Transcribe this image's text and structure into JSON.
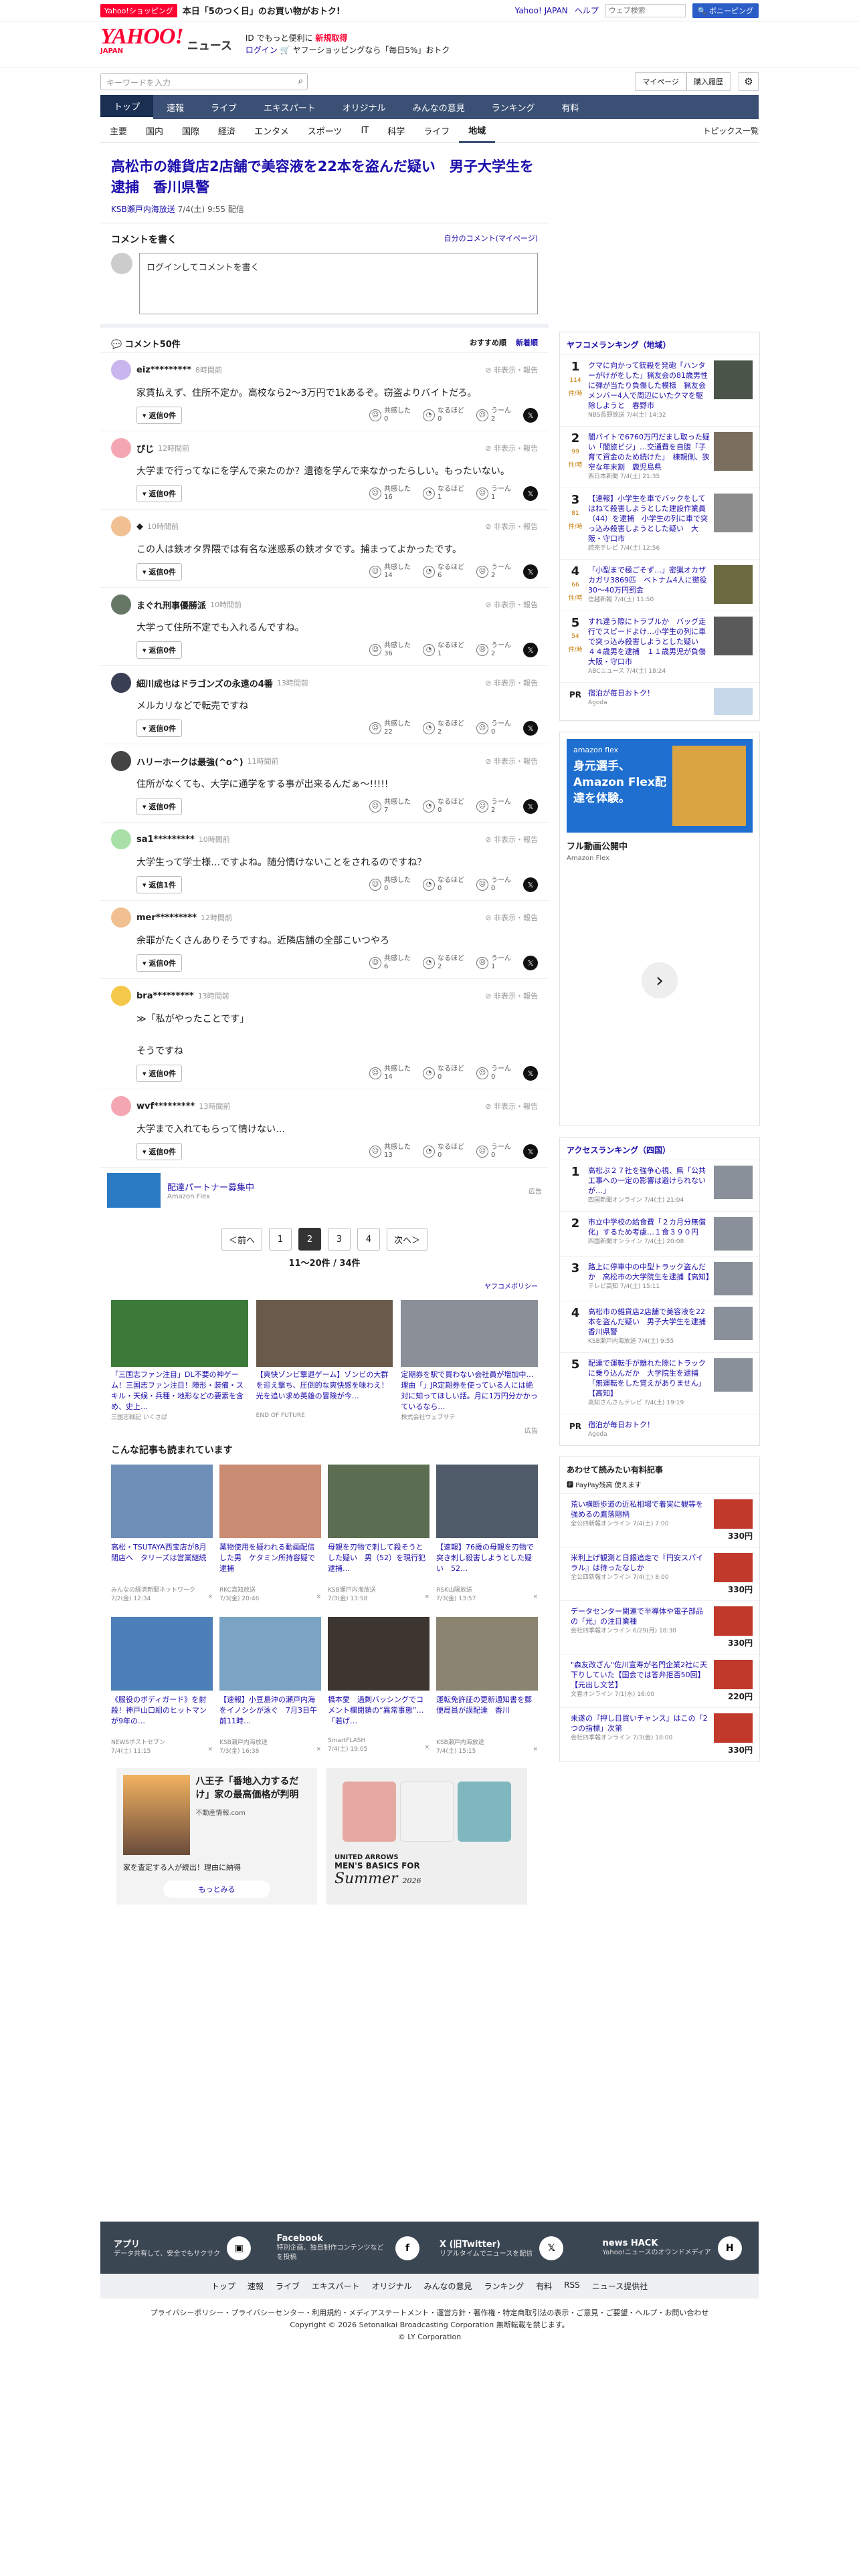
{
  "topbar": {
    "promo_tag": "Yahoo!ショッピング",
    "promo_text": "本日「5のつく日」のお買い物がおトク!",
    "links": [
      "Yahoo! JAPAN",
      "ヘルプ"
    ],
    "search_placeholder": "ウェブ検索",
    "search_btn": "🔍 ボニーピング"
  },
  "header": {
    "logo": "YAHOO!",
    "logo_sub": "JAPAN",
    "section": "ニュース",
    "notice1": "ID でもっと便利に",
    "notice_red": "新規取得",
    "notice2": "ログイン",
    "notice3": "ヤフーショッピングなら「毎日5%」おトク"
  },
  "search": {
    "placeholder": "キーワードを入力",
    "mypage": "マイページ",
    "history": "購入履歴"
  },
  "nav": [
    "トップ",
    "速報",
    "ライブ",
    "エキスパート",
    "オリジナル",
    "みんなの意見",
    "ランキング",
    "有料"
  ],
  "subnav": [
    "主要",
    "国内",
    "国際",
    "経済",
    "エンタメ",
    "スポーツ",
    "IT",
    "科学",
    "ライフ",
    "地域"
  ],
  "subnav_right": "トピックス一覧",
  "article": {
    "title": "高松市の雑貨店2店舗で美容液を22本を盗んだ疑い　男子大学生を逮捕　香川県警",
    "source": "KSB瀬戸内海放送",
    "date": "7/4(土) 9:55 配信"
  },
  "comment_box": {
    "title": "コメントを書く",
    "mylink": "自分のコメント(マイページ)",
    "placeholder": "ログインしてコメントを書く"
  },
  "comments_header": {
    "count": "コメント50件",
    "sort1": "おすすめ順",
    "sort2": "新着順"
  },
  "comments": [
    {
      "user": "eiz*********",
      "time": "8時間前",
      "report": "非表示・報告",
      "body": "家賃払えず、住所不定か。高校なら2～3万円で1kあるぞ。窃盗よりバイトだろ。",
      "reply": "返信0件",
      "r1": "0",
      "r2": "0",
      "r3": "2",
      "color": "#c9b6ef"
    },
    {
      "user": "ぴじ",
      "time": "12時間前",
      "report": "非表示・報告",
      "body": "大学まで行ってなにを学んで来たのか？遺徳を学んで来なかったらしい。もったいない。",
      "reply": "返信0件",
      "r1": "16",
      "r2": "1",
      "r3": "1",
      "color": "#f4a7b3"
    },
    {
      "user": "◆",
      "time": "10時間前",
      "report": "非表示・報告",
      "body": "この人は鉄オタ界隈では有名な迷惑系の鉄オタです。捕まってよかったです。",
      "reply": "返信0件",
      "r1": "14",
      "r2": "6",
      "r3": "2",
      "color": "#f1c092"
    },
    {
      "user": "まぐれ刑事優勝派",
      "time": "10時間前",
      "report": "非表示・報告",
      "body": "大学って住所不定でも入れるんですね。",
      "reply": "返信0件",
      "r1": "36",
      "r2": "1",
      "r3": "2",
      "color": "#667766"
    },
    {
      "user": "細川成也はドラゴンズの永遠の4番",
      "time": "13時間前",
      "report": "非表示・報告",
      "body": "メルカリなどで転売ですね",
      "reply": "返信0件",
      "r1": "22",
      "r2": "2",
      "r3": "0",
      "color": "#3a3f55"
    },
    {
      "user": "ハリーホークは最強(^o^)",
      "time": "11時間前",
      "report": "非表示・報告",
      "body": "住所がなくても、大学に通学をする事が出来るんだぁ～!!!!!",
      "reply": "返信0件",
      "r1": "7",
      "r2": "0",
      "r3": "2",
      "color": "#444444"
    },
    {
      "user": "sa1*********",
      "time": "10時間前",
      "report": "非表示・報告",
      "body": "大学生って学士様…ですよね。随分情けないことをされるのですね？",
      "reply": "返信1件",
      "r1": "0",
      "r2": "0",
      "r3": "0",
      "color": "#a8e0a8"
    },
    {
      "user": "mer*********",
      "time": "12時間前",
      "report": "非表示・報告",
      "body": "余罪がたくさんありそうですね。近隣店舗の全部こいつやろ",
      "reply": "返信0件",
      "r1": "6",
      "r2": "2",
      "r3": "1",
      "color": "#f1c092"
    },
    {
      "user": "bra*********",
      "time": "13時間前",
      "report": "非表示・報告",
      "body": "≫「私がやったことです」\n\nそうですね",
      "reply": "返信0件",
      "r1": "14",
      "r2": "0",
      "r3": "0",
      "color": "#f4c94a"
    },
    {
      "user": "wvf*********",
      "time": "13時間前",
      "report": "非表示・報告",
      "body": "大学まで入れてもらって情けない…",
      "reply": "返信0件",
      "r1": "13",
      "r2": "0",
      "r3": "0",
      "color": "#f4a7b3"
    }
  ],
  "reaction_labels": {
    "a": "共感した",
    "b": "なるほど",
    "c": "うーん"
  },
  "ad_partner": {
    "title": "配達パートナー募集中",
    "sub": "Amazon Flex",
    "ad": "広告"
  },
  "pager": {
    "prev": "＜前へ",
    "pages": [
      "1",
      "2",
      "3",
      "4"
    ],
    "current": "2",
    "next": "次へ＞",
    "count": "11〜20件 / 34件"
  },
  "sponsor": "ヤフコメポリシー",
  "promo_cards": [
    {
      "t": "「三国志ファン注目」DL不要の神ゲーム！三国志ファン注目！陣形・装備・スキル・天候・兵種・地形などの要素を含め、史上…",
      "s": "三国志戦記 いくさば",
      "bg": "#3d7a3a"
    },
    {
      "t": "【爽快ゾンビ撃退ゲーム】ゾンビの大群を迎え撃ち、圧倒的な爽快感を味わえ！光を追い求め英雄の冒険が今…",
      "s": "END OF FUTURE",
      "bg": "#6a5a4a"
    },
    {
      "t": "定期券を駅で買わない会社員が増加中…理由「」JR定期券を使っている人には絶対に知ってほしい話。月に1万円分かかっているなら…",
      "s": "株式会社ウェブサテ",
      "bg": "#8a8f98"
    }
  ],
  "ad_label": "広告",
  "read_heading": "こんな記事も読まれています",
  "read_cards": [
    {
      "t": "高松・TSUTAYA西宝店が8月閉店へ　タリーズは営業継続",
      "s": "みんなの経済新聞ネットワーク",
      "d": "7/2(金) 12:34",
      "bg": "#6d8fb7"
    },
    {
      "t": "薬物使用を疑われる動画配信した男　ケタミン所持容疑で逮捕",
      "s": "RKC高知放送",
      "d": "7/3(金) 20:46",
      "bg": "#c98c73"
    },
    {
      "t": "母親を刃物で刺して殺そうとした疑い　男（52）を現行犯逮捕…",
      "s": "KSB瀬戸内海放送",
      "d": "7/3(金) 13:58",
      "bg": "#5c6e52"
    },
    {
      "t": "【速報】76歳の母親を刃物で突き刺し殺害しようとした疑い　52…",
      "s": "RSK山陽放送",
      "d": "7/3(金) 13:57",
      "bg": "#4f5b68"
    },
    {
      "t": "《服役のボディガード》を射殺！神戸山口組のヒットマンが9年の…",
      "s": "NEWSポストセブン",
      "d": "7/4(土) 11:15",
      "bg": "#4d80b9"
    },
    {
      "t": "【速報】小豆島沖の瀬戸内海をイノシシが泳ぐ　7月3日午前11時…",
      "s": "KSB瀬戸内海放送",
      "d": "7/3(金) 16:38",
      "bg": "#7ba4c4"
    },
    {
      "t": "橋本愛　過剰バッシングでコメント欄閉鎖の“異常事態”…「若げ…",
      "s": "SmartFLASH",
      "d": "7/4(土) 19:05",
      "bg": "#3c3530"
    },
    {
      "t": "運転免許証の更新通知書を郵便局員が誤配達　香川",
      "s": "KSB瀬戸内海放送",
      "d": "7/4(土) 15:15",
      "bg": "#8a8470"
    }
  ],
  "house_ad": {
    "head": "八王子「番地入力するだけ」家の最高価格が判明",
    "site": "不動産情報.com",
    "desc": "家を査定する人が続出！理由に納得",
    "btn": "もっとみる"
  },
  "cloth_ad": {
    "brand": "UNITED ARROWS",
    "text": "MEN'S BASICS FOR",
    "summer": "Summer",
    "year": "2026"
  },
  "side_rank": {
    "title": "ヤフコメランキング（地域）",
    "items": [
      {
        "n": "1",
        "c": "114",
        "cu": "件/時",
        "t": "クマに向かって銃殺を発砲「ハンターがけがをした」猟友会の81歳男性に弾が当たり負傷した模様　猟友会メンバー4人で周辺にいたクマを駆除しようと　春野市",
        "s": "NBS長野放送 7/4(土) 14:32",
        "bg": "#4a5448"
      },
      {
        "n": "2",
        "c": "99",
        "cu": "件/時",
        "t": "闇バイトで6760万円だまし取った疑い「闇旅ビジ」…交通費を自腹「子育て資金のため続けた」　棟親側、狭窄な年末割　鹿児島県",
        "s": "西日本新聞 7/4(土) 21:35",
        "bg": "#7a6e5e"
      },
      {
        "n": "3",
        "c": "81",
        "cu": "件/時",
        "t": "【速報】小学生を車でバックをしてはねて殺害しようとした建設作業員（44）を逮捕　小学生の列に車で突っ込み殺害しようとした疑い　大阪・守口市",
        "s": "読売テレビ 7/4(土) 12:56",
        "bg": "#8c8c8c"
      },
      {
        "n": "4",
        "c": "66",
        "cu": "件/時",
        "t": "「小型まで極ごそず…」密猟オカザカガリ3869匹　ベトナム4人に懲役30～40万円罰金",
        "s": "信越新報 7/4(土) 11:50",
        "bg": "#6b6a40"
      },
      {
        "n": "5",
        "c": "54",
        "cu": "件/時",
        "t": "すれ違う際にトラブルか　バッグ走行でスピードよけ…小学生の列に車で突っ込み殺害しようとした疑い　４４歳男を逮捕　１１歳男児が負傷　大阪・守口市",
        "s": "ABCニュース 7/4(土) 18:24",
        "bg": "#5a5a5a"
      }
    ],
    "pr_text": "宿泊が毎日おトク！",
    "pr_src": "Agoda"
  },
  "amazon_ad": {
    "brand": "amazon flex",
    "headline": "身元選手、Amazon Flex配達を体験。",
    "caption": "フル動画公開中",
    "sub": "Amazon Flex"
  },
  "access_rank": {
    "title": "アクセスランキング（四国）",
    "items": [
      {
        "n": "1",
        "t": "高松ぷ２７社を強争心視、県「公共工事への一定の影響は避けられないが…」",
        "s": "四国新聞オンライン 7/4(土) 21:04"
      },
      {
        "n": "2",
        "t": "市立中学校の給食費「２カ月分無償化」するため考慮…１食３９０円",
        "s": "四国新聞オンライン 7/4(土) 20:08"
      },
      {
        "n": "3",
        "t": "路上に停車中の中型トラック盗んだか　高松市の大学院生を逮捕【高知】",
        "s": "テレビ高知 7/4(土) 15:11"
      },
      {
        "n": "4",
        "t": "高松市の雑貨店2店舗で美容液を22本を盗んだ疑い　男子大学生を逮捕　香川県警",
        "s": "KSB瀬戸内海放送 7/4(土) 9:55"
      },
      {
        "n": "5",
        "t": "配達で運転手が離れた隙にトラックに乗り込んだか　大学院生を逮捕「無運転をした覚えがありません」【高知】",
        "s": "高知さんさんテレビ 7/4(土) 19:19"
      }
    ],
    "pr_text": "宿泊が毎日おトク！",
    "pr_src": "Agoda"
  },
  "paid": {
    "title": "あわせて読みたい有料記事",
    "sub": "PayPay残高 使えます",
    "items": [
      {
        "t": "荒い横断歩道の近私相場で着実に観等を強めるの鷹落剛柄",
        "s": "全公四新報オンライン 7/4(土) 7:00",
        "p": "330円"
      },
      {
        "t": "米利上げ観測と日銀追走で『円安スパイラル』は待ったなしか",
        "s": "全公四新報オンライン 7/4(土) 8:00",
        "p": "330円"
      },
      {
        "t": "データセンター関連で半導体や電子部品の「光」の注目業種",
        "s": "会社四季報オンライン 6/29(月) 18:30",
        "p": "330円"
      },
      {
        "t": "\"森友改ざん\"佐川宣寿が名門企業2社に天下りしていた【国会では答弁拒否50回】【元出し文艺】",
        "s": "文春オンライン 7/1(水) 16:00",
        "p": "220円"
      },
      {
        "t": "未遂の『押し目買いチャンス』はこの「2つの指標」次第",
        "s": "会社四季報オンライン 7/3(金) 18:00",
        "p": "330円"
      }
    ]
  },
  "footer": {
    "cols": [
      {
        "t": "アプリ",
        "s": "データ共有して、安全でもサクサク"
      },
      {
        "t": "Facebook",
        "s": "特別企画、独自制作コンテンツなどを投稿"
      },
      {
        "t": "X (旧Twitter)",
        "s": "リアルタイムでニュースを配信"
      },
      {
        "t": "news HACK",
        "s": "Yahoo!ニュースのオウンドメディア"
      }
    ],
    "links": [
      "トップ",
      "速報",
      "ライブ",
      "エキスパート",
      "オリジナル",
      "みんなの意見",
      "ランキング",
      "有料",
      "RSS",
      "ニュース提供社"
    ],
    "policy": "プライバシーポリシー・プライバシーセンター・利用規約・メディアステートメント・運営方針・著作権・特定商取引法の表示・ご意見・ご要望・ヘルプ・お問い合わせ",
    "copy1": "Copyright © 2026 Setonaikai Broadcasting Corporation 無断転載を禁じます。",
    "copy2": "© LY Corporation"
  }
}
